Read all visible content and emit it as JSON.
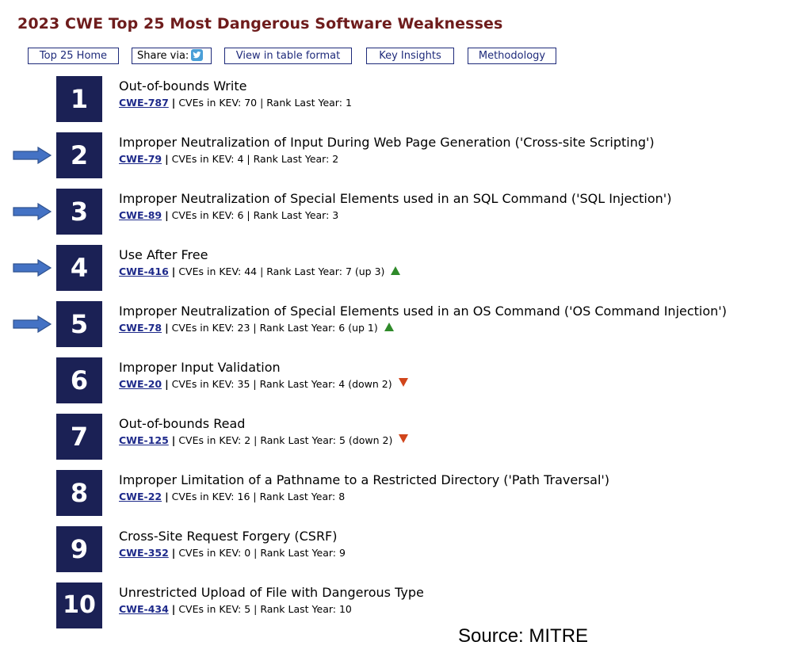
{
  "title": "2023 CWE Top 25 Most Dangerous Software Weaknesses",
  "nav": {
    "home": "Top 25 Home",
    "share": "Share via:",
    "table": "View in table format",
    "insights": "Key Insights",
    "methodology": "Methodology"
  },
  "colors": {
    "title": "#6e1c1c",
    "rank_box": "#1b2155",
    "link": "#1e2a8a",
    "arrow": "#4472c4",
    "up": "#2f8a2a",
    "down": "#d1451b"
  },
  "kev_label": "CVEs in KEV:",
  "last_year_label": "Rank Last Year:",
  "items": [
    {
      "rank": "1",
      "name": "Out-of-bounds Write",
      "cwe": "CWE-787",
      "kev": "70",
      "last_year": "1",
      "change": "",
      "trend": "none",
      "arrow": false
    },
    {
      "rank": "2",
      "name": "Improper Neutralization of Input During Web Page Generation ('Cross-site Scripting')",
      "cwe": "CWE-79",
      "kev": "4",
      "last_year": "2",
      "change": "",
      "trend": "none",
      "arrow": true
    },
    {
      "rank": "3",
      "name": "Improper Neutralization of Special Elements used in an SQL Command ('SQL Injection')",
      "cwe": "CWE-89",
      "kev": "6",
      "last_year": "3",
      "change": "",
      "trend": "none",
      "arrow": true
    },
    {
      "rank": "4",
      "name": "Use After Free",
      "cwe": "CWE-416",
      "kev": "44",
      "last_year": "7",
      "change": "(up 3)",
      "trend": "up",
      "arrow": true
    },
    {
      "rank": "5",
      "name": "Improper Neutralization of Special Elements used in an OS Command ('OS Command Injection')",
      "cwe": "CWE-78",
      "kev": "23",
      "last_year": "6",
      "change": "(up 1)",
      "trend": "up",
      "arrow": true
    },
    {
      "rank": "6",
      "name": "Improper Input Validation",
      "cwe": "CWE-20",
      "kev": "35",
      "last_year": "4",
      "change": "(down 2)",
      "trend": "down",
      "arrow": false
    },
    {
      "rank": "7",
      "name": "Out-of-bounds Read",
      "cwe": "CWE-125",
      "kev": "2",
      "last_year": "5",
      "change": "(down 2)",
      "trend": "down",
      "arrow": false
    },
    {
      "rank": "8",
      "name": "Improper Limitation of a Pathname to a Restricted Directory ('Path Traversal')",
      "cwe": "CWE-22",
      "kev": "16",
      "last_year": "8",
      "change": "",
      "trend": "none",
      "arrow": false
    },
    {
      "rank": "9",
      "name": "Cross-Site Request Forgery (CSRF)",
      "cwe": "CWE-352",
      "kev": "0",
      "last_year": "9",
      "change": "",
      "trend": "none",
      "arrow": false
    },
    {
      "rank": "10",
      "name": "Unrestricted Upload of File with Dangerous Type",
      "cwe": "CWE-434",
      "kev": "5",
      "last_year": "10",
      "change": "",
      "trend": "none",
      "arrow": false
    }
  ],
  "source": "Source: MITRE"
}
